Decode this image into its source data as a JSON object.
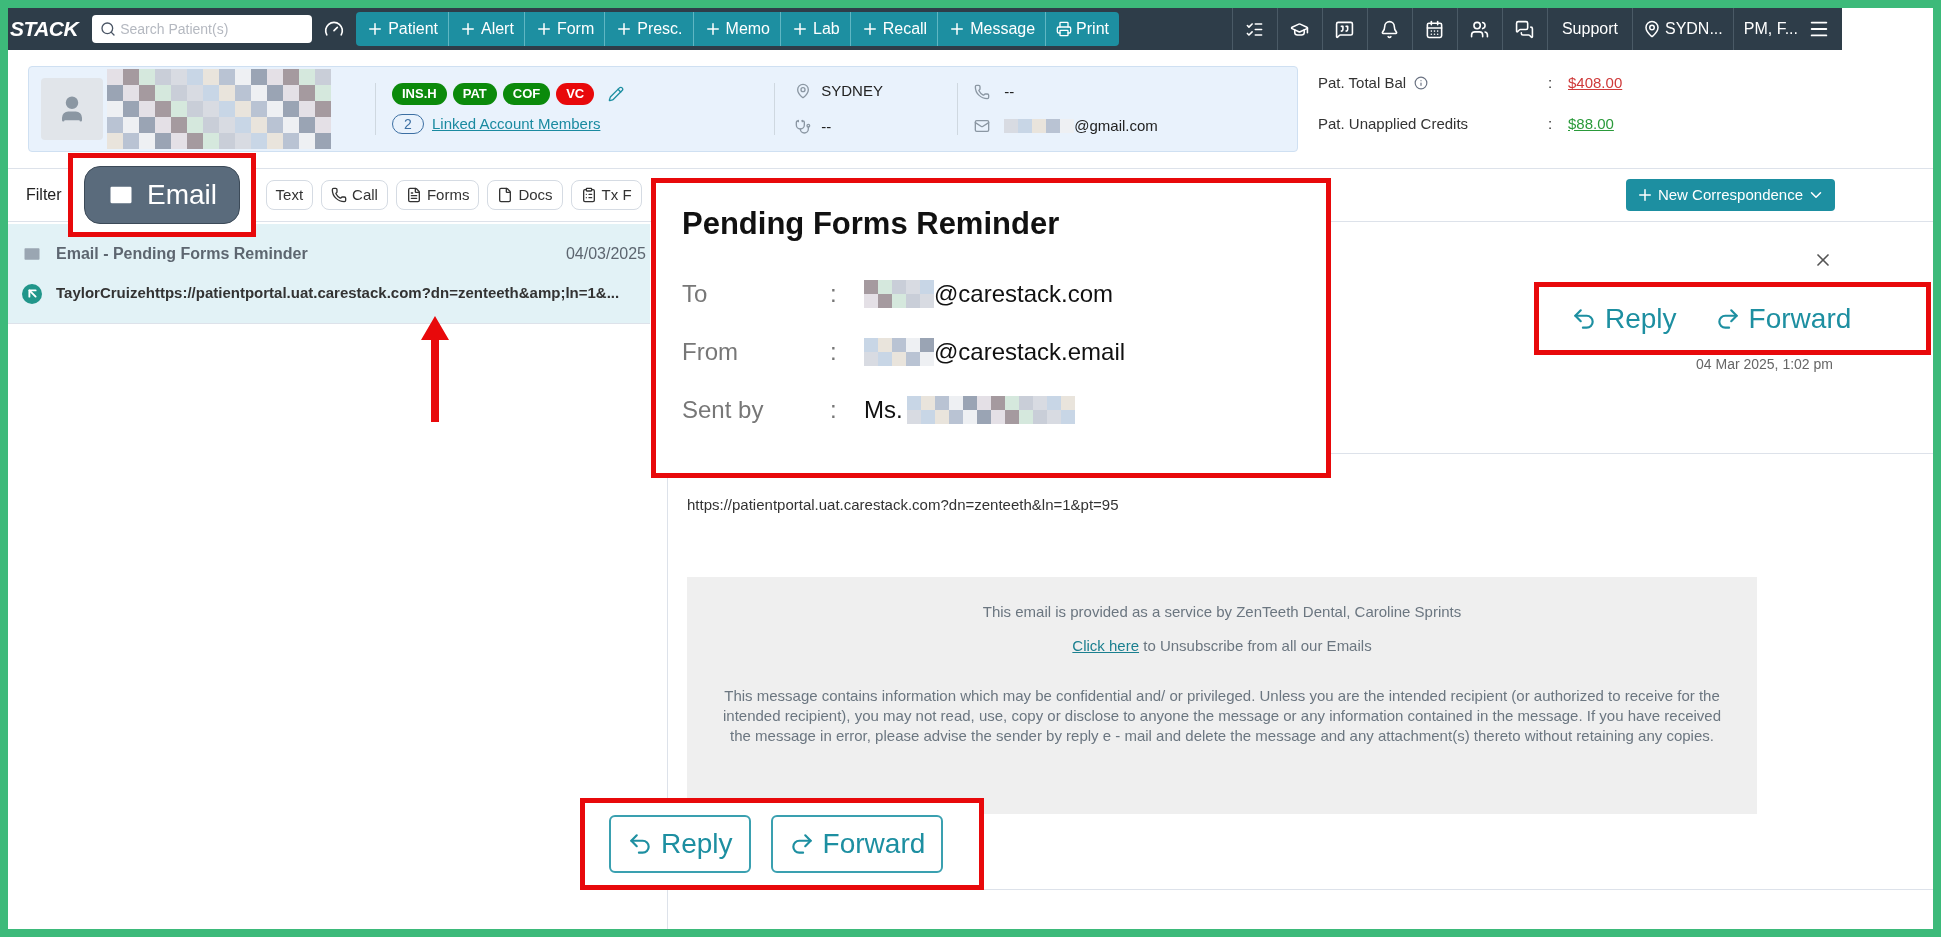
{
  "top_bar": {
    "logo": "STACK",
    "search": {
      "placeholder": "Search Patient(s)"
    },
    "quick_actions": [
      {
        "label": "Patient",
        "kind": "add"
      },
      {
        "label": "Alert",
        "kind": "add"
      },
      {
        "label": "Form",
        "kind": "add"
      },
      {
        "label": "Presc.",
        "kind": "add"
      },
      {
        "label": "Memo",
        "kind": "add"
      },
      {
        "label": "Lab",
        "kind": "add"
      },
      {
        "label": "Recall",
        "kind": "add"
      },
      {
        "label": "Message",
        "kind": "add"
      },
      {
        "label": "Print",
        "kind": "print"
      }
    ],
    "support": "Support",
    "location": "SYDN...",
    "user": "PM, F..."
  },
  "patient": {
    "flags": [
      {
        "label": "INS.H",
        "color": "#0b8a0b"
      },
      {
        "label": "PAT",
        "color": "#0b8a0b"
      },
      {
        "label": "COF",
        "color": "#0b8a0b"
      },
      {
        "label": "VC",
        "color": "#e8090b"
      }
    ],
    "linked": {
      "count": "2",
      "label": "Linked Account Members"
    },
    "location": "SYDNEY",
    "provider": "--",
    "phone": "--",
    "email": "@gmail.com"
  },
  "balances": [
    {
      "label": "Pat. Total Bal",
      "separator": ":",
      "value": "$408.00",
      "kind": "due"
    },
    {
      "label": "Pat. Unapplied Credits",
      "separator": ":",
      "value": "$88.00",
      "kind": "credit"
    }
  ],
  "filter": {
    "label": "Filter",
    "chips": [
      {
        "label": "Text",
        "kind": "text"
      },
      {
        "label": "Call",
        "kind": "call"
      },
      {
        "label": "Forms",
        "kind": "forms"
      },
      {
        "label": "Docs",
        "kind": "docs"
      },
      {
        "label": "Tx F",
        "kind": "plans"
      }
    ]
  },
  "new_correspondence": "New Correspondence",
  "messages": [
    {
      "title": "Email - Pending Forms Reminder",
      "date": "04/03/2025",
      "preview": "TaylorCruizehttps://patientportal.uat.carestack.com?dn=zenteeth&amp;ln=1&...",
      "selected": true
    }
  ],
  "detail": {
    "date": "04 Mar 2025, 1:02 pm",
    "url": "https://patientportal.uat.carestack.com?dn=zenteeth&ln=1&pt=95",
    "footer": {
      "service": "This email is provided as a service by ZenTeeth Dental, Caroline Sprints",
      "link": "Click here",
      "link_rest": "to Unsubscribe from all our Emails",
      "disclaimer": "This message contains information which may be confidential and/ or privileged. Unless you are the intended recipient (or authorized to receive for the intended recipient), you may not read, use, copy or disclose to anyone the message or any information contained in the message. If you have received the message in error, please advise the sender by reply e - mail and delete the message and any attachment(s) thereto without retaining any copies."
    },
    "actions": [
      {
        "label": "Reply",
        "kind": "reply"
      },
      {
        "label": "Forward",
        "kind": "forward"
      }
    ]
  },
  "callouts": {
    "filter_chip": "Email",
    "header": {
      "subject": "Pending Forms Reminder",
      "fields": [
        {
          "label": "To",
          "separator": ":",
          "value": "@carestack.com"
        },
        {
          "label": "From",
          "separator": ":",
          "value": "@carestack.email"
        },
        {
          "label": "Sent by",
          "separator": ":",
          "value": "Ms."
        }
      ]
    },
    "header_actions": [
      {
        "label": "Reply",
        "kind": "reply"
      },
      {
        "label": "Forward",
        "kind": "forward"
      }
    ]
  }
}
